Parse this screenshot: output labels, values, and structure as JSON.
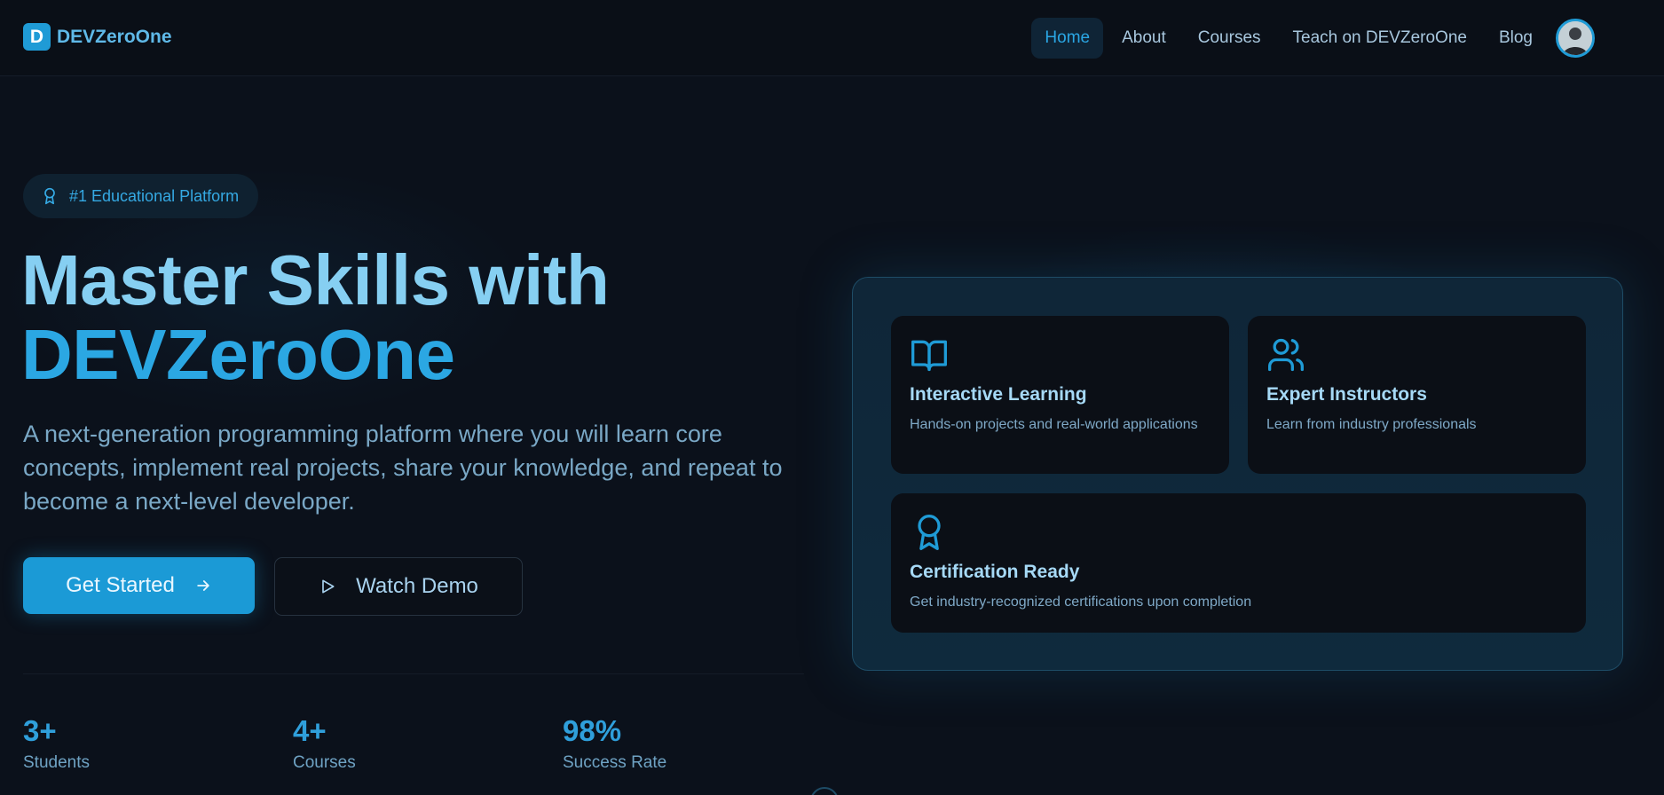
{
  "brand": {
    "mark": "D",
    "name": "DEVZeroOne"
  },
  "nav": {
    "items": [
      {
        "label": "Home",
        "active": true
      },
      {
        "label": "About"
      },
      {
        "label": "Courses"
      },
      {
        "label": "Teach on DEVZeroOne"
      },
      {
        "label": "Blog"
      }
    ]
  },
  "hero": {
    "badge": "#1 Educational Platform",
    "title_line1": "Master Skills with",
    "title_line2": "DEVZeroOne",
    "lead": "A next-generation programming platform where you will learn core concepts, implement real projects, share your knowledge, and repeat to become a next-level developer.",
    "cta_primary": "Get Started",
    "cta_secondary": "Watch Demo"
  },
  "stats": [
    {
      "value": "3+",
      "label": "Students"
    },
    {
      "value": "4+",
      "label": "Courses"
    },
    {
      "value": "98%",
      "label": "Success Rate"
    }
  ],
  "features": [
    {
      "icon": "book-open-icon",
      "title": "Interactive Learning",
      "desc": "Hands-on projects and real-world applications"
    },
    {
      "icon": "users-icon",
      "title": "Expert Instructors",
      "desc": "Learn from industry professionals"
    },
    {
      "icon": "award-icon",
      "title": "Certification Ready",
      "desc": "Get industry-recognized certifications upon completion"
    }
  ],
  "colors": {
    "accent": "#1f9bd6",
    "background": "#0b111b",
    "title": "#86cff2"
  }
}
